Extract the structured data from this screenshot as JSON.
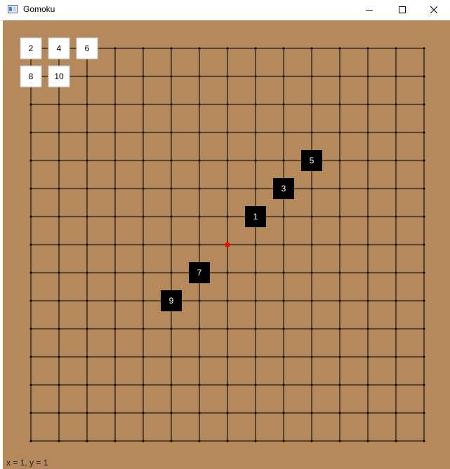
{
  "window": {
    "title": "Gomoku",
    "buttons": [
      "minimize",
      "maximize",
      "close"
    ]
  },
  "board": {
    "size": 15,
    "background": "#b5895c",
    "line_color": "#000000",
    "last_move_marker_color": "#ff0000",
    "last_move_marker": {
      "col": 7,
      "row": 7
    },
    "stones": [
      {
        "number": "1",
        "color": "black",
        "col": 8,
        "row": 6
      },
      {
        "number": "2",
        "color": "white",
        "col": 0,
        "row": 0
      },
      {
        "number": "3",
        "color": "black",
        "col": 9,
        "row": 5
      },
      {
        "number": "4",
        "color": "white",
        "col": 1,
        "row": 0
      },
      {
        "number": "5",
        "color": "black",
        "col": 10,
        "row": 4
      },
      {
        "number": "6",
        "color": "white",
        "col": 2,
        "row": 0
      },
      {
        "number": "7",
        "color": "black",
        "col": 6,
        "row": 8
      },
      {
        "number": "8",
        "color": "white",
        "col": 0,
        "row": 1
      },
      {
        "number": "9",
        "color": "black",
        "col": 5,
        "row": 9
      },
      {
        "number": "10",
        "color": "white",
        "col": 1,
        "row": 1
      }
    ]
  },
  "status": "x = 1, y = 1"
}
